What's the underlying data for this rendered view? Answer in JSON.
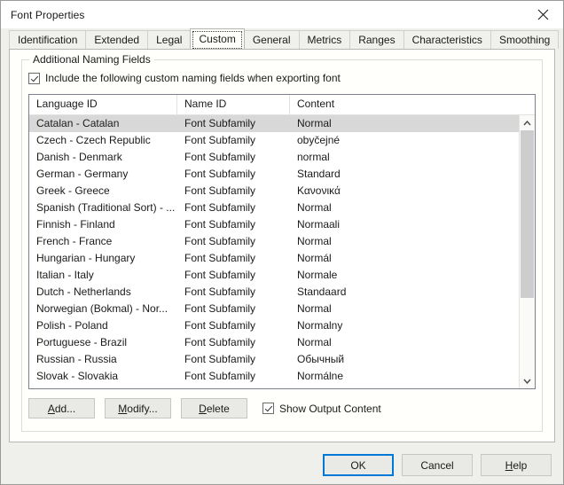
{
  "window": {
    "title": "Font Properties",
    "close_icon": "close-icon"
  },
  "tabs": [
    {
      "label": "Identification",
      "selected": false
    },
    {
      "label": "Extended",
      "selected": false
    },
    {
      "label": "Legal",
      "selected": false
    },
    {
      "label": "Custom",
      "selected": true
    },
    {
      "label": "General",
      "selected": false
    },
    {
      "label": "Metrics",
      "selected": false
    },
    {
      "label": "Ranges",
      "selected": false
    },
    {
      "label": "Characteristics",
      "selected": false
    },
    {
      "label": "Smoothing",
      "selected": false
    }
  ],
  "group": {
    "legend": "Additional Naming Fields",
    "include_checkbox": {
      "label": "Include the following custom naming fields when exporting font",
      "checked": true
    }
  },
  "list": {
    "columns": [
      "Language ID",
      "Name ID",
      "Content"
    ],
    "selected_index": 0,
    "rows": [
      {
        "language": "Catalan - Catalan",
        "name_id": "Font Subfamily",
        "content": "Normal"
      },
      {
        "language": "Czech - Czech Republic",
        "name_id": "Font Subfamily",
        "content": "obyčejné"
      },
      {
        "language": "Danish - Denmark",
        "name_id": "Font Subfamily",
        "content": "normal"
      },
      {
        "language": "German - Germany",
        "name_id": "Font Subfamily",
        "content": "Standard"
      },
      {
        "language": "Greek - Greece",
        "name_id": "Font Subfamily",
        "content": "Κανονικά"
      },
      {
        "language": "Spanish (Traditional Sort) - ...",
        "name_id": "Font Subfamily",
        "content": "Normal"
      },
      {
        "language": "Finnish - Finland",
        "name_id": "Font Subfamily",
        "content": "Normaali"
      },
      {
        "language": "French - France",
        "name_id": "Font Subfamily",
        "content": "Normal"
      },
      {
        "language": "Hungarian - Hungary",
        "name_id": "Font Subfamily",
        "content": "Normál"
      },
      {
        "language": "Italian - Italy",
        "name_id": "Font Subfamily",
        "content": "Normale"
      },
      {
        "language": "Dutch - Netherlands",
        "name_id": "Font Subfamily",
        "content": "Standaard"
      },
      {
        "language": "Norwegian (Bokmal) - Nor...",
        "name_id": "Font Subfamily",
        "content": "Normal"
      },
      {
        "language": "Polish - Poland",
        "name_id": "Font Subfamily",
        "content": "Normalny"
      },
      {
        "language": "Portuguese - Brazil",
        "name_id": "Font Subfamily",
        "content": "Normal"
      },
      {
        "language": "Russian - Russia",
        "name_id": "Font Subfamily",
        "content": "Обычный"
      },
      {
        "language": "Slovak - Slovakia",
        "name_id": "Font Subfamily",
        "content": "Normálne"
      }
    ],
    "scrollbar": {
      "up_icon": "chevron-up-icon",
      "down_icon": "chevron-down-icon",
      "thumb_fraction": 0.69
    }
  },
  "group_buttons": {
    "add": {
      "prefix": "",
      "accel": "A",
      "suffix": "dd..."
    },
    "modify": {
      "prefix": "",
      "accel": "M",
      "suffix": "odify..."
    },
    "delete": {
      "prefix": "",
      "accel": "D",
      "suffix": "elete"
    },
    "show_output": {
      "label": "Show Output Content",
      "checked": true
    }
  },
  "footer": {
    "ok": "OK",
    "cancel": "Cancel",
    "help": {
      "accel": "H",
      "suffix": "elp"
    }
  },
  "colors": {
    "accent": "#0078d7",
    "selection": "#d8d8d8",
    "dialog_bg": "#efefeb",
    "page_bg": "#fffffc"
  }
}
